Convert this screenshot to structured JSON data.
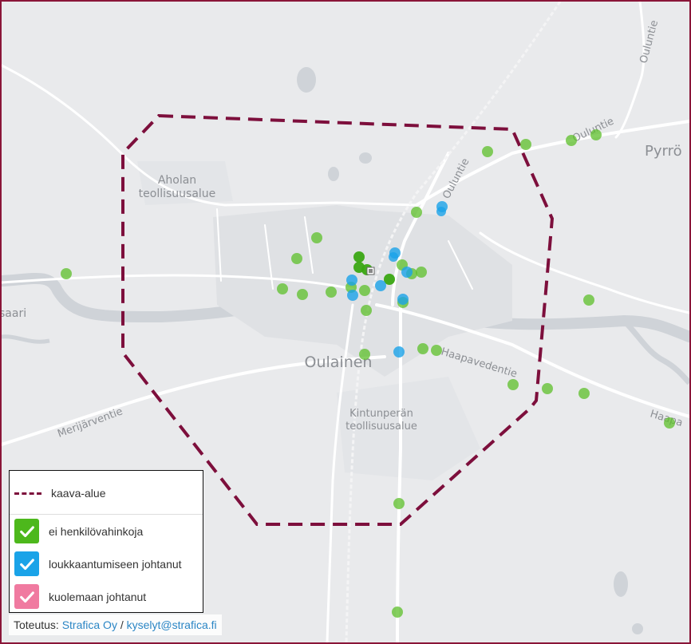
{
  "map": {
    "place_labels": {
      "aholan_line1": "Aholan",
      "aholan_line2": "teollisuusalue",
      "saari": "saari",
      "oulainen": "Oulainen",
      "kintunpera_line1": "Kintunperän",
      "kintunpera_line2": "teollisuusalue",
      "pyrro": "Pyrrö"
    },
    "road_labels": {
      "ouluntie_top": "Ouluntie",
      "ouluntie_ne": "Ouluntie",
      "ouluntie_center": "Ouluntie",
      "haapavedentie": "Haapavedentie",
      "haapa_edge": "Haapa",
      "merijarventie": "Merijärventie"
    },
    "colors": {
      "background": "#e9eaec",
      "water": "#cfd3d8",
      "road": "#ffffff",
      "boundary": "#7d0f3c",
      "no_injury": "#4db81c",
      "injury": "#1aa3e8",
      "fatal": "#f07aa0",
      "frame": "#8a1538"
    }
  },
  "legend": {
    "items": [
      {
        "id": "boundary",
        "label": "kaava-alue",
        "symbol": "dashed-line"
      },
      {
        "id": "no_injury",
        "label": "ei henkilövahinkoja",
        "symbol": "check-icon",
        "color": "#4db81c"
      },
      {
        "id": "injury",
        "label": "loukkaantumiseen johtanut",
        "symbol": "check-icon",
        "color": "#1aa3e8"
      },
      {
        "id": "fatal",
        "label": "kuolemaan johtanut",
        "symbol": "check-icon",
        "color": "#f07aa0"
      }
    ]
  },
  "credits": {
    "prefix": "Toteutus: ",
    "company": "Strafica Oy",
    "separator": " / ",
    "email": "kyselyt@strafica.fi"
  }
}
